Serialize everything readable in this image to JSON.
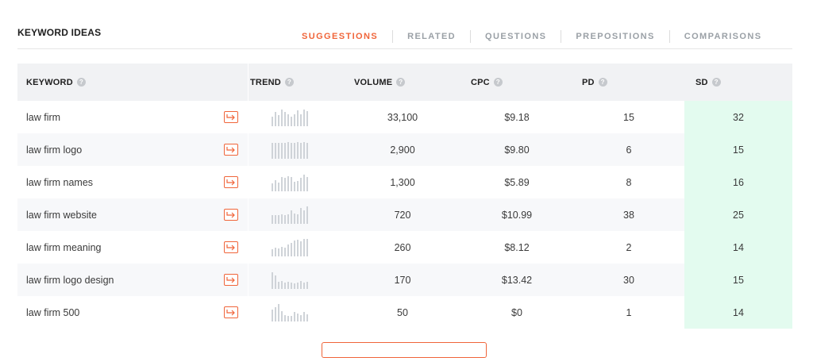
{
  "section": {
    "title": "KEYWORD IDEAS"
  },
  "tabs": [
    {
      "label": "SUGGESTIONS",
      "active": true
    },
    {
      "label": "RELATED",
      "active": false
    },
    {
      "label": "QUESTIONS",
      "active": false
    },
    {
      "label": "PREPOSITIONS",
      "active": false
    },
    {
      "label": "COMPARISONS",
      "active": false
    }
  ],
  "table": {
    "headers": {
      "keyword": "KEYWORD",
      "trend": "TREND",
      "volume": "VOLUME",
      "cpc": "CPC",
      "pd": "PD",
      "sd": "SD"
    },
    "rows": [
      {
        "keyword": "law firm",
        "volume": "33,100",
        "cpc": "$9.18",
        "pd": "15",
        "sd": "32",
        "trend": [
          0.55,
          0.8,
          0.65,
          0.95,
          0.8,
          0.7,
          0.55,
          0.7,
          0.9,
          0.7,
          0.95,
          0.85
        ]
      },
      {
        "keyword": "law firm logo",
        "volume": "2,900",
        "cpc": "$9.80",
        "pd": "6",
        "sd": "15",
        "trend": [
          0.9,
          0.9,
          0.9,
          0.9,
          0.9,
          0.95,
          0.9,
          0.9,
          0.95,
          0.9,
          0.95,
          0.9
        ]
      },
      {
        "keyword": "law firm names",
        "volume": "1,300",
        "cpc": "$5.89",
        "pd": "8",
        "sd": "16",
        "trend": [
          0.45,
          0.65,
          0.5,
          0.8,
          0.75,
          0.85,
          0.8,
          0.55,
          0.6,
          0.75,
          0.95,
          0.8
        ]
      },
      {
        "keyword": "law firm website",
        "volume": "720",
        "cpc": "$10.99",
        "pd": "38",
        "sd": "25",
        "trend": [
          0.5,
          0.5,
          0.5,
          0.55,
          0.5,
          0.55,
          0.75,
          0.6,
          0.55,
          0.9,
          0.75,
          1.0
        ]
      },
      {
        "keyword": "law firm meaning",
        "volume": "260",
        "cpc": "$8.12",
        "pd": "2",
        "sd": "14",
        "trend": [
          0.4,
          0.5,
          0.45,
          0.55,
          0.5,
          0.7,
          0.75,
          0.9,
          0.95,
          0.85,
          1.0,
          1.0
        ]
      },
      {
        "keyword": "law firm logo design",
        "volume": "170",
        "cpc": "$13.42",
        "pd": "30",
        "sd": "15",
        "trend": [
          0.95,
          0.75,
          0.4,
          0.45,
          0.35,
          0.4,
          0.35,
          0.3,
          0.35,
          0.45,
          0.35,
          0.4
        ]
      },
      {
        "keyword": "law firm 500",
        "volume": "50",
        "cpc": "$0",
        "pd": "1",
        "sd": "14",
        "trend": [
          0.7,
          0.8,
          1.0,
          0.6,
          0.35,
          0.3,
          0.3,
          0.55,
          0.45,
          0.35,
          0.55,
          0.4
        ]
      }
    ]
  },
  "icons": {
    "open": "open-arrow-icon",
    "help": "question-circle-icon"
  },
  "colors": {
    "accent": "#f0653a",
    "sd_highlight": "#e3fbef",
    "trend_bar": "#cfd3d8"
  }
}
